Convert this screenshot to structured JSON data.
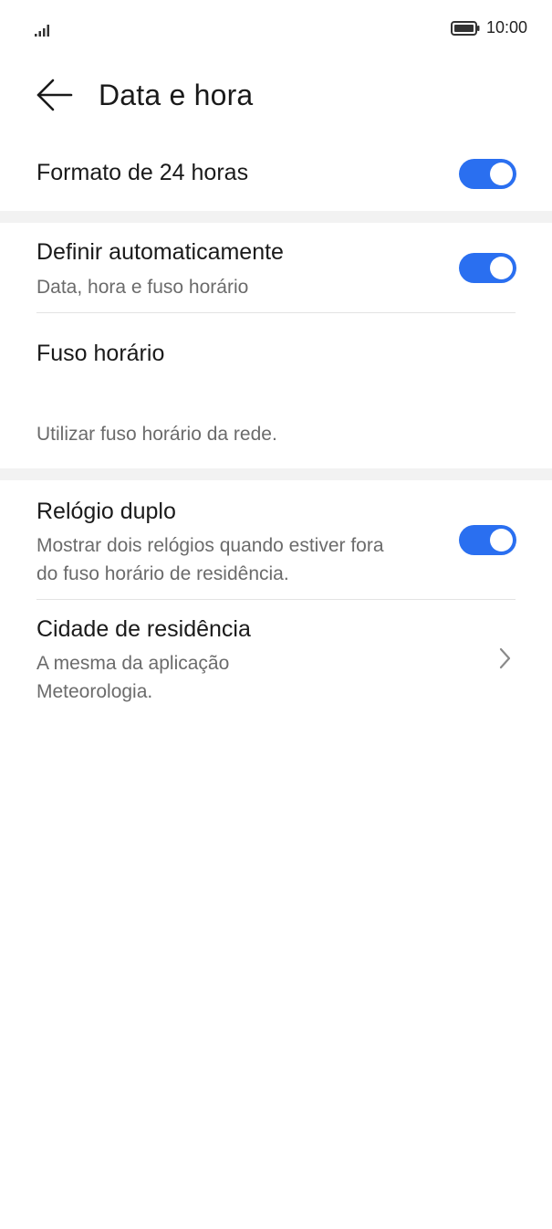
{
  "status_bar": {
    "time": "10:00",
    "signal_icon": "signal-icon",
    "battery_icon": "battery-icon"
  },
  "header": {
    "back_icon": "back-arrow-icon",
    "title": "Data e hora"
  },
  "settings": {
    "format_24h": {
      "title": "Formato de 24 horas",
      "enabled": true
    },
    "auto_set": {
      "title": "Definir automaticamente",
      "subtitle": "Data, hora e fuso horário",
      "enabled": true
    },
    "time_zone": {
      "title": "Fuso horário"
    },
    "network_note": "Utilizar fuso horário da rede.",
    "dual_clock": {
      "title": "Relógio duplo",
      "subtitle_line1": "Mostrar dois relógios quando estiver fora",
      "subtitle_line2": "do fuso horário de residência.",
      "enabled": true
    },
    "home_city": {
      "title": "Cidade de residência",
      "subtitle_line1": "A mesma da aplicação",
      "subtitle_line2": "Meteorologia.",
      "chevron_icon": "chevron-right-icon"
    }
  },
  "colors": {
    "accent": "#2a6ff0",
    "section_gap": "#f2f2f2",
    "secondary_text": "#6b6b6b"
  }
}
